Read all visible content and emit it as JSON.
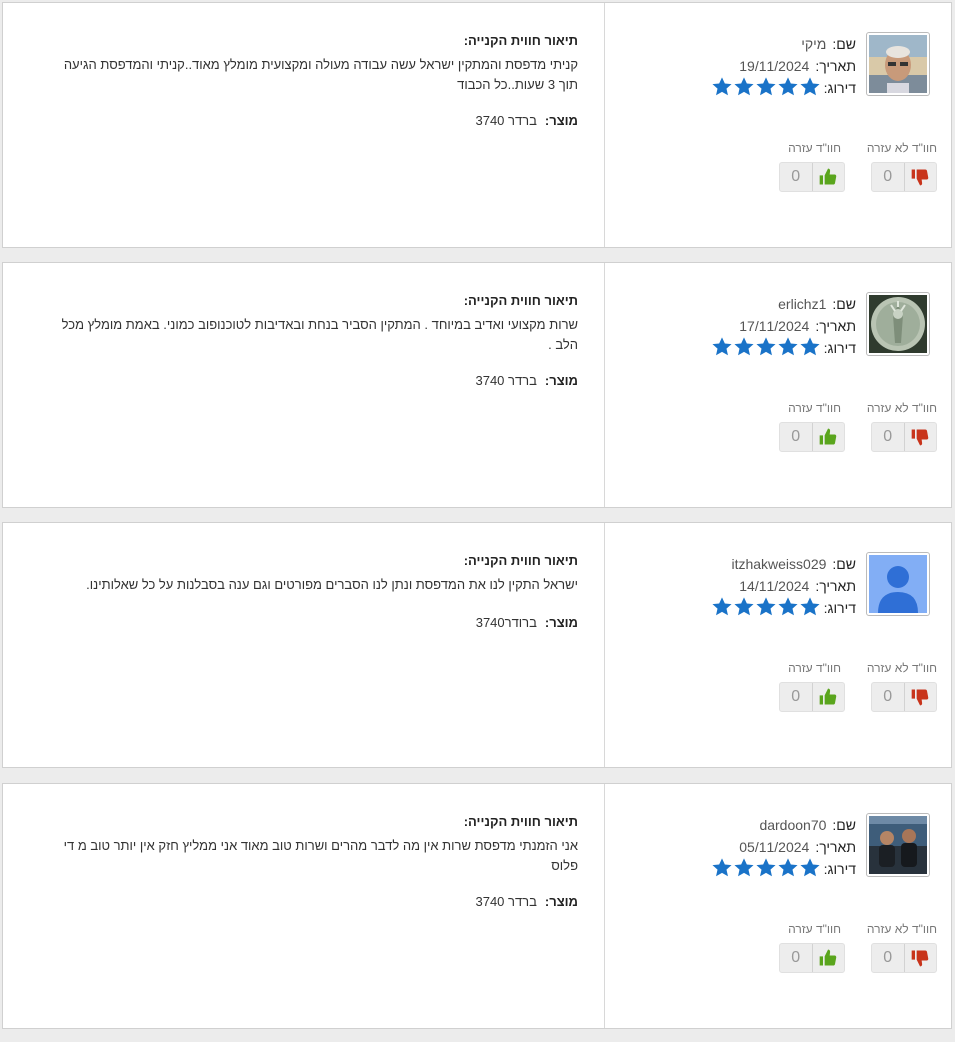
{
  "labels": {
    "name": "שם:",
    "date": "תאריך:",
    "rating": "דירוג:",
    "helpful": "חוו\"ד עזרה",
    "not_helpful": "חוו\"ד לא עזרה",
    "description_title": "תיאור חווית הקנייה:",
    "product": "מוצר:"
  },
  "colors": {
    "star": "#1a73c8",
    "thumb_up": "#5aa51d",
    "thumb_down": "#c8341b"
  },
  "reviews": [
    {
      "name": "מיקי",
      "date": "19/11/2024",
      "rating": 5,
      "avatar": "photo-older-man",
      "text": "קניתי מדפסת והמתקין ישראל עשה עבודה מעולה ומקצועית מומלץ מאוד..קניתי והמדפסת הגיעה תוך 3 שעות..כל הכבוד",
      "product": "ברדר 3740",
      "helpful": "0",
      "not_helpful": "0"
    },
    {
      "name": "erlichz1",
      "date": "17/11/2024",
      "rating": 5,
      "avatar": "photo-statue-of-liberty-coin",
      "text": "שרות מקצועי ואדיב במיוחד . המתקין הסביר בנחת ובאדיבות לטוכנופוב כמוני. באמת מומלץ מכל הלב .",
      "product": "ברדר 3740",
      "helpful": "0",
      "not_helpful": "0"
    },
    {
      "name": "itzhakweiss029",
      "date": "14/11/2024",
      "rating": 5,
      "avatar": "default-user-silhouette",
      "text": "ישראל התקין לנו את המדפסת ונתן לנו הסברים מפורטים וגם ענה בסבלנות על כל שאלותינו.",
      "product": "ברודר3740",
      "helpful": "0",
      "not_helpful": "0"
    },
    {
      "name": "dardoon70",
      "date": "05/11/2024",
      "rating": 5,
      "avatar": "photo-two-young-men",
      "text": "אני הזמנתי מדפסת שרות אין מה לדבר מהרים ושרות טוב מאוד אני ממליץ חזק אין יותר טוב מ די פלוס",
      "product": "ברדר 3740",
      "helpful": "0",
      "not_helpful": "0"
    }
  ]
}
